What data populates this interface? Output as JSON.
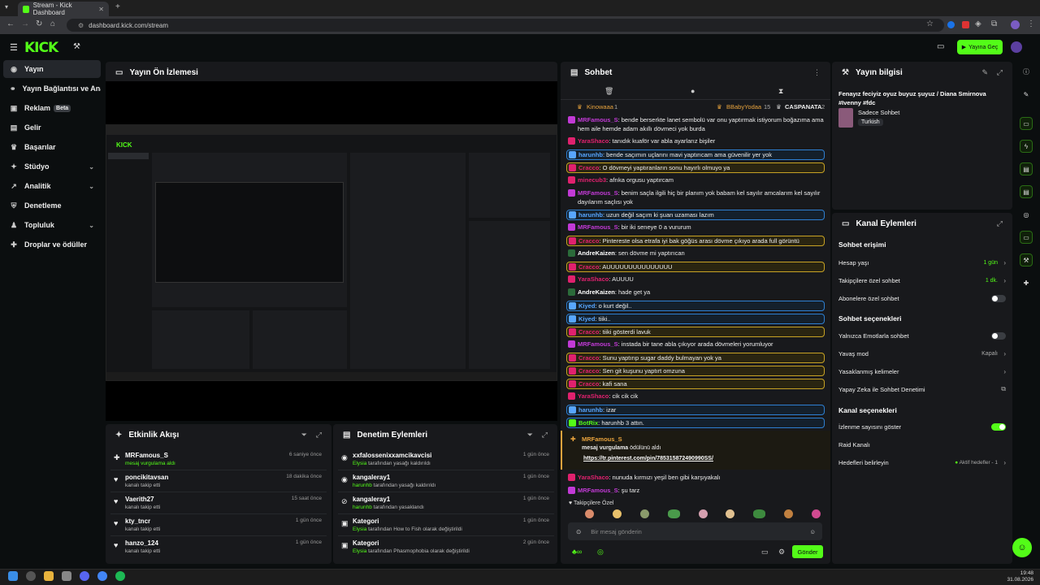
{
  "browser": {
    "tab_title": "Stream - Kick Dashboard",
    "url": "dashboard.kick.com/stream"
  },
  "header": {
    "logo": "KICK",
    "go_live": "Yayına Geç",
    "accent": "#53fc18"
  },
  "sidebar": {
    "items": [
      {
        "label": "Yayın",
        "icon": "dot-icon"
      },
      {
        "label": "Yayın Bağlantısı ve Anahtar",
        "icon": "link-icon"
      },
      {
        "label": "Reklam",
        "badge": "Beta",
        "icon": "ad-icon"
      },
      {
        "label": "Gelir",
        "icon": "money-icon"
      },
      {
        "label": "Başarılar",
        "icon": "trophy-icon"
      },
      {
        "label": "Stüdyo",
        "icon": "studio-icon"
      },
      {
        "label": "Analitik",
        "icon": "chart-icon"
      },
      {
        "label": "Denetleme",
        "icon": "shield-icon"
      },
      {
        "label": "Topluluk",
        "icon": "users-icon"
      },
      {
        "label": "Droplar ve ödüller",
        "icon": "gift-icon"
      }
    ]
  },
  "preview": {
    "title": "Yayın Ön İzlemesi"
  },
  "activity": {
    "title": "Etkinlik Akışı",
    "rows": [
      {
        "name": "MRFamous_S",
        "desc": "mesaj vurgulama aldı",
        "time": "6 saniye önce",
        "icon": "gift-icon"
      },
      {
        "name": "poncikitavsan",
        "desc": "kanalı takip etti",
        "time": "18 dakika önce",
        "icon": "heart-icon"
      },
      {
        "name": "Vaerith27",
        "desc": "kanalı takip etti",
        "time": "15 saat önce",
        "icon": "heart-icon"
      },
      {
        "name": "kty_tncr",
        "desc": "kanalı takip etti",
        "time": "1 gün önce",
        "icon": "heart-icon"
      },
      {
        "name": "hanzo_124",
        "desc": "kanalı takip etti",
        "time": "1 gün önce",
        "icon": "heart-icon"
      }
    ]
  },
  "moderation": {
    "title": "Denetim Eylemleri",
    "rows": [
      {
        "name": "xxfalossenixxamcikavcisi",
        "by": "Elysia",
        "desc": "tarafından yasağı kaldırıldı",
        "time": "1 gün önce"
      },
      {
        "name": "kangaleray1",
        "by": "harunhb",
        "desc": "tarafından yasağı kaldırıldı",
        "time": "1 gün önce"
      },
      {
        "name": "kangaleray1",
        "by": "harunhb",
        "desc": "tarafından yasaklandı",
        "time": "1 gün önce"
      },
      {
        "name": "Kategori",
        "by": "Elysia",
        "desc": "tarafından How to Fish olarak değiştirildi",
        "time": "1 gün önce"
      },
      {
        "name": "Kategori",
        "by": "Elysia",
        "desc": "tarafından Phasmophobia olarak değiştirildi",
        "time": "2 gün önce"
      }
    ]
  },
  "chat": {
    "title": "Sohbet",
    "top_gifters": [
      {
        "name": "Kinowaaa",
        "count": "1"
      },
      {
        "name": "BBabyYodaa",
        "count": "15"
      },
      {
        "name": "CASPANATA",
        "count": "2"
      }
    ],
    "messages": [
      {
        "user": "MRFamous_S",
        "color": "#c23ad6",
        "text": ": bende berserkte lanet sembolü var onu yaptırmak istiyorum boğazıma ama hem aile hemde adam akıllı dövmeci yok burda"
      },
      {
        "user": "YaraShaco",
        "color": "#e0216e",
        "text": ": tanıdık kuaför var abla ayarlarız bişiler"
      },
      {
        "user": "harunhb",
        "color": "#58a6ff",
        "text": ": bende saçımın uçlarını mavi yaptırıcam ama güvenilir yer yok",
        "hl": "blue"
      },
      {
        "user": "Cracco",
        "color": "#e0216e",
        "text": ": O dövmeyi yaptıranların sonu hayırlı olmuyo ya",
        "hl": "yellow"
      },
      {
        "user": "minecub3",
        "color": "#e0216e",
        "text": ": afrıka orgusu yaptırcam"
      },
      {
        "user": "MRFamous_S",
        "color": "#c23ad6",
        "text": ": benim saçla ilgili hiç bir planım yok babam kel sayılır amcalarım kel sayılır dayılarım saçlısı yok"
      },
      {
        "user": "harunhb",
        "color": "#58a6ff",
        "text": ": uzun değil saçım ki şuan uzaması lazım",
        "hl": "blue"
      },
      {
        "user": "MRFamous_S",
        "color": "#c23ad6",
        "text": ": bir iki seneye 0 a vururum"
      },
      {
        "user": "Cracco",
        "color": "#e0216e",
        "text": ": Pintereste olsa etrafa iyi bak göğüs arası dövme çıkıyo arada full görüntü",
        "hl": "yellow"
      },
      {
        "user": "AndreKaizen",
        "color": "#ffffff",
        "text": ": sen dövme mi yaptırıcan"
      },
      {
        "user": "Cracco",
        "color": "#e0216e",
        "text": ": AUUUUUUUUUUUUUUU",
        "hl": "yellow"
      },
      {
        "user": "YaraShaco",
        "color": "#e0216e",
        "text": ": AUUUU"
      },
      {
        "user": "AndreKaizen",
        "color": "#ffffff",
        "text": ": hade get ya"
      },
      {
        "user": "Kiyed",
        "color": "#58a6ff",
        "text": ": o kurt değil..",
        "hl": "blue"
      },
      {
        "user": "Kiyed",
        "color": "#58a6ff",
        "text": ": tiiki..",
        "hl": "blue"
      },
      {
        "user": "Cracco",
        "color": "#e0216e",
        "text": ": tiiki gösterdi lavuk",
        "hl": "yellow"
      },
      {
        "user": "MRFamous_S",
        "color": "#c23ad6",
        "text": ": instada bir tane abla çıkıyor arada dövmeleri yorumluyor"
      },
      {
        "user": "Cracco",
        "color": "#e0216e",
        "text": ": Sunu yaptırıp sugar daddy bulmayan yok ya",
        "hl": "yellow"
      },
      {
        "user": "Cracco",
        "color": "#e0216e",
        "text": ": Sen git kuşunu yaptırt omzuna",
        "hl": "yellow"
      },
      {
        "user": "Cracco",
        "color": "#e0216e",
        "text": ": kafi sana",
        "hl": "yellow"
      },
      {
        "user": "YaraShaco",
        "color": "#e0216e",
        "text": ": cik cik cik"
      },
      {
        "user": "harunhb",
        "color": "#58a6ff",
        "text": ": izar",
        "hl": "blue"
      },
      {
        "user": "BotRix",
        "color": "#53fc18",
        "text": ": harunhb 3 attın.",
        "hl": "blue"
      }
    ],
    "pinned": {
      "user": "MRFamous_S",
      "reward": "mesaj vurgulama",
      "reward_suffix": "ödülünü aldı",
      "link": "https://tr.pinterest.com/pin/785315872490990SS/"
    },
    "after": [
      {
        "user": "YaraShaco",
        "color": "#e0216e",
        "text": ": nunuda kırmızı yeşil ben gibi karşıyakalı"
      },
      {
        "user": "MRFamous_S",
        "color": "#c23ad6",
        "text": ": şu tarz"
      }
    ],
    "followers_only": "Takipçilere Özel",
    "input_placeholder": "Bir mesaj gönderin",
    "send": "Gönder"
  },
  "stream_info": {
    "title": "Yayın bilgisi",
    "stream_title": "Fenayız feciyiz oyuz buyuz şuyuz / Diana Smirnova #Ivenny #fdc",
    "category": "Sadece Sohbet",
    "language": "Turkish"
  },
  "channel_actions": {
    "title": "Kanal Eylemleri",
    "chat_access": "Sohbet erişimi",
    "account_age": {
      "label": "Hesap yaşı",
      "value": "1 gün"
    },
    "followers_only": {
      "label": "Takipçilere özel sohbet",
      "value": "1 dk."
    },
    "subs_only": {
      "label": "Abonelere özel sohbet"
    },
    "chat_options": "Sohbet seçenekleri",
    "emotes_only": {
      "label": "Yalnızca Emotlarla sohbet"
    },
    "slow_mode": {
      "label": "Yavaş mod",
      "value": "Kapalı"
    },
    "banned_words": {
      "label": "Yasaklanmış kelimeler"
    },
    "ai_mod": {
      "label": "Yapay Zeka ile Sohbet Denetimi"
    },
    "channel_options": "Kanal seçenekleri",
    "viewer_count": {
      "label": "İzlenme sayısını göster"
    },
    "raid": {
      "label": "Raid Kanalı"
    },
    "goals": {
      "label": "Hedefleri belirleyin",
      "value": "Aktif hedefler - 1"
    }
  },
  "taskbar": {
    "time": "19:48",
    "date": "31.08.2026"
  }
}
